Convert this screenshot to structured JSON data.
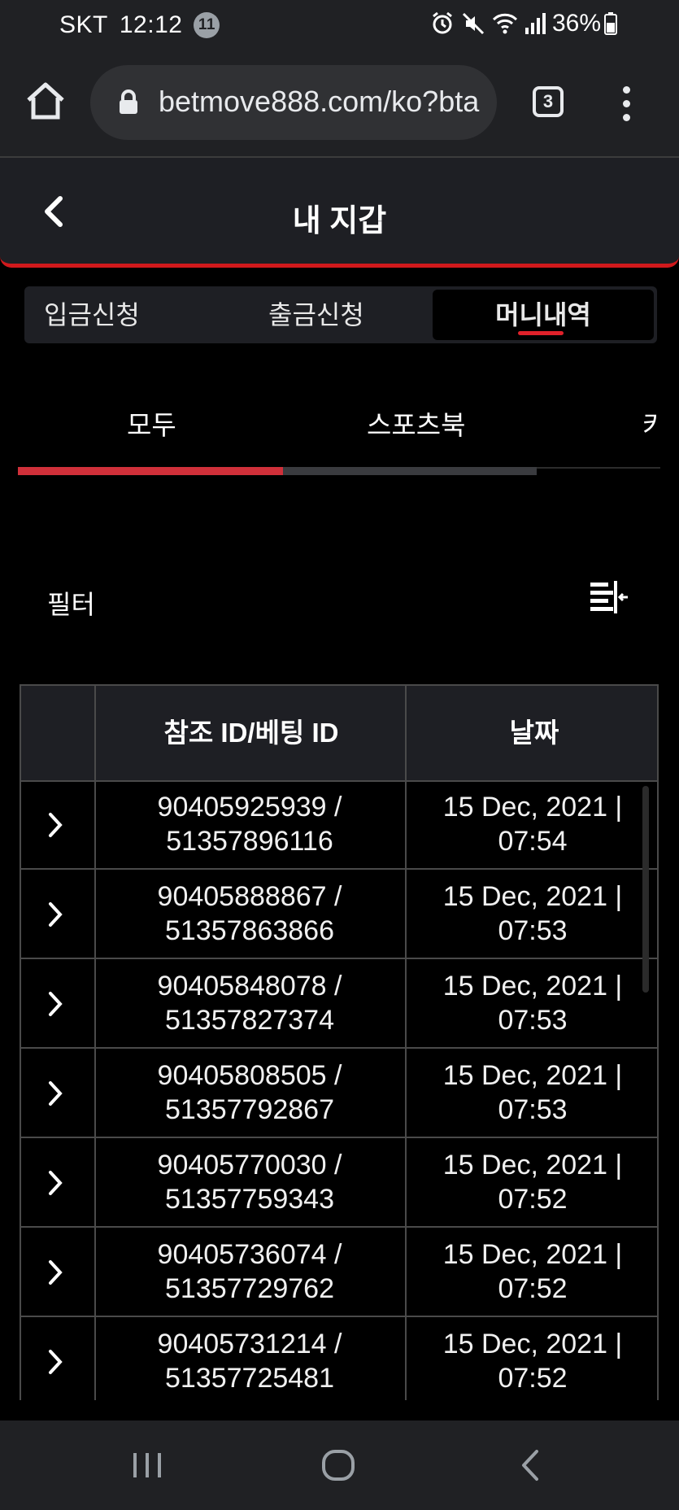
{
  "status_bar": {
    "carrier": "SKT",
    "time": "12:12",
    "notification_count": "11",
    "battery": "36%"
  },
  "browser": {
    "url": "betmove888.com/ko?bta",
    "tab_count": "3"
  },
  "header": {
    "title": "내 지갑"
  },
  "main_tabs": [
    {
      "label": "입금신청",
      "active": false
    },
    {
      "label": "출금신청",
      "active": false
    },
    {
      "label": "머니내역",
      "active": true
    }
  ],
  "sub_tabs": [
    {
      "label": "모두",
      "active": true
    },
    {
      "label": "스포츠북",
      "active": false
    },
    {
      "label": "카",
      "active": false
    }
  ],
  "filter": {
    "label": "필터"
  },
  "table": {
    "headers": [
      "",
      "참조 ID/베팅 ID",
      "날짜"
    ],
    "rows": [
      {
        "ref_line1": "90405925939 /",
        "ref_line2": "51357896116",
        "date_line1": "15 Dec, 2021 |",
        "date_line2": "07:54"
      },
      {
        "ref_line1": "90405888867 /",
        "ref_line2": "51357863866",
        "date_line1": "15 Dec, 2021 |",
        "date_line2": "07:53"
      },
      {
        "ref_line1": "90405848078 /",
        "ref_line2": "51357827374",
        "date_line1": "15 Dec, 2021 |",
        "date_line2": "07:53"
      },
      {
        "ref_line1": "90405808505 /",
        "ref_line2": "51357792867",
        "date_line1": "15 Dec, 2021 |",
        "date_line2": "07:53"
      },
      {
        "ref_line1": "90405770030 /",
        "ref_line2": "51357759343",
        "date_line1": "15 Dec, 2021 |",
        "date_line2": "07:52"
      },
      {
        "ref_line1": "90405736074 /",
        "ref_line2": "51357729762",
        "date_line1": "15 Dec, 2021 |",
        "date_line2": "07:52"
      },
      {
        "ref_line1": "90405731214 /",
        "ref_line2": "51357725481",
        "date_line1": "15 Dec, 2021 |",
        "date_line2": "07:52"
      }
    ]
  },
  "icons": {
    "home": "home-icon",
    "lock": "lock-icon",
    "back": "back-arrow-icon",
    "filter": "filter-collapse-icon",
    "row_expand": "chevron-right-icon",
    "nav_recent": "recent-apps-icon",
    "nav_home": "nav-home-icon",
    "nav_back": "nav-back-icon"
  },
  "colors": {
    "accent": "#d0191c",
    "background": "#000000",
    "panel": "#1e1f24"
  }
}
